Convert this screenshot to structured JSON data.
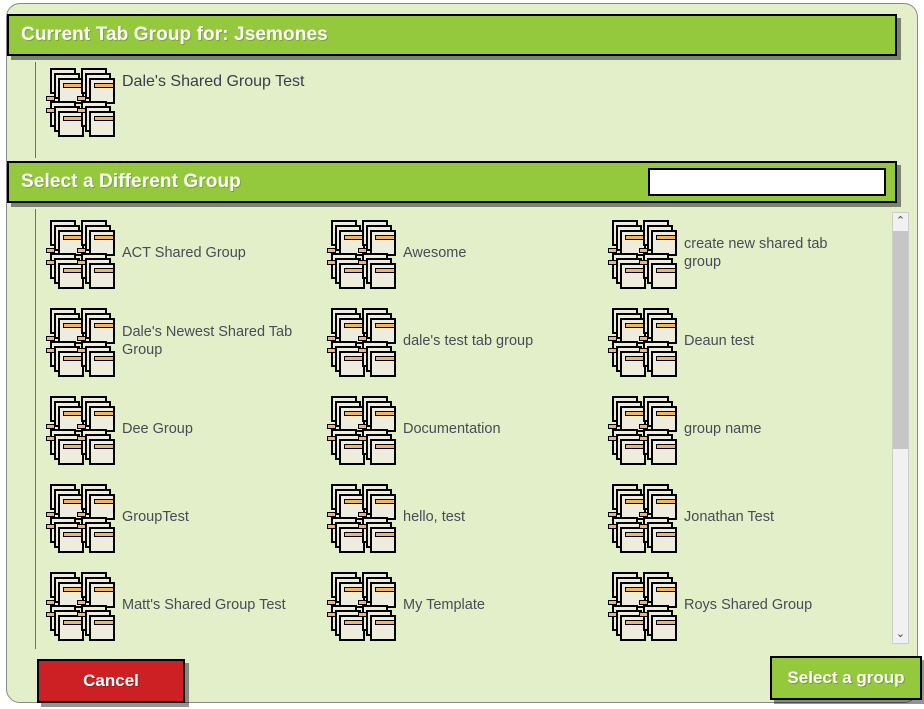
{
  "panel": {
    "background_color": "#e3efc8",
    "accent_green": "#95c93d",
    "cancel_red": "#cc2024"
  },
  "current_group_section": {
    "header_title": "Current Tab Group for: Jsemones",
    "item": {
      "icon": "tab-group-icon",
      "label": "Dale's Shared Group Test"
    }
  },
  "select_group_section": {
    "header_title": "Select a Different Group",
    "search": {
      "value": "",
      "placeholder": ""
    },
    "groups": [
      {
        "icon": "tab-group-icon",
        "label": "ACT Shared Group"
      },
      {
        "icon": "tab-group-icon",
        "label": "Awesome"
      },
      {
        "icon": "tab-group-icon",
        "label": "create new shared tab group"
      },
      {
        "icon": "tab-group-icon",
        "label": "Dale's Newest Shared Tab Group"
      },
      {
        "icon": "tab-group-icon",
        "label": "dale's test tab group"
      },
      {
        "icon": "tab-group-icon",
        "label": "Deaun test"
      },
      {
        "icon": "tab-group-icon",
        "label": "Dee Group"
      },
      {
        "icon": "tab-group-icon",
        "label": "Documentation"
      },
      {
        "icon": "tab-group-icon",
        "label": "group name"
      },
      {
        "icon": "tab-group-icon",
        "label": "GroupTest"
      },
      {
        "icon": "tab-group-icon",
        "label": "hello, test"
      },
      {
        "icon": "tab-group-icon",
        "label": "Jonathan Test"
      },
      {
        "icon": "tab-group-icon",
        "label": "Matt's Shared Group Test"
      },
      {
        "icon": "tab-group-icon",
        "label": "My Template"
      },
      {
        "icon": "tab-group-icon",
        "label": "Roys Shared Group"
      }
    ]
  },
  "scrollbar": {
    "up_arrow": "⌃",
    "down_arrow": "⌄"
  },
  "footer": {
    "cancel_label": "Cancel",
    "select_label": "Select a group"
  }
}
